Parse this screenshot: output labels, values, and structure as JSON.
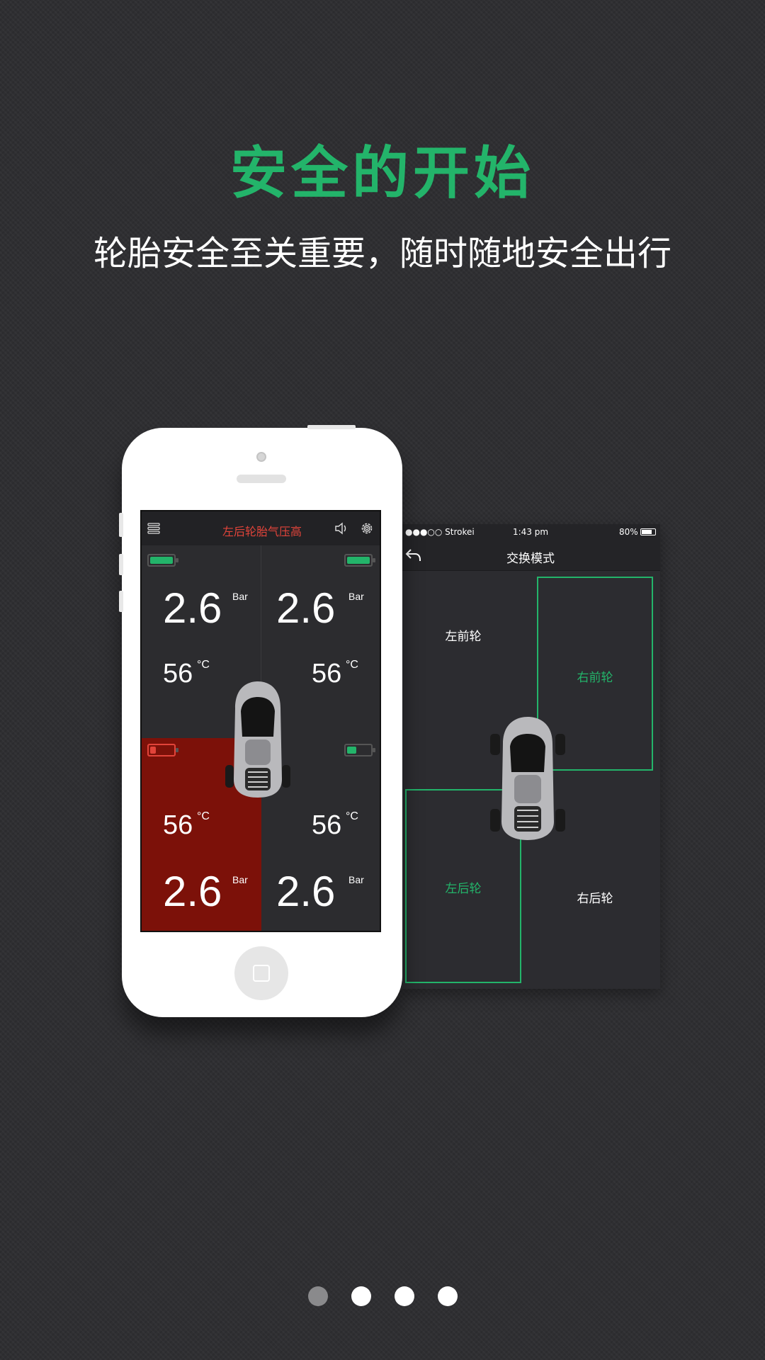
{
  "headline": "安全的开始",
  "subhead": "轮胎安全至关重要，随时随地安全出行",
  "phone_screen": {
    "alert_text": "左后轮胎气压高",
    "menu_icon": "menu-icon",
    "volume_icon": "speaker-icon",
    "settings_icon": "gear-icon",
    "tires": {
      "front_left": {
        "pressure": "2.6",
        "pressure_unit": "Bar",
        "temperature": "56",
        "temp_unit": "°C",
        "battery_level": 1.0,
        "battery_color": "#23b46a",
        "status": "normal"
      },
      "front_right": {
        "pressure": "2.6",
        "pressure_unit": "Bar",
        "temperature": "56",
        "temp_unit": "°C",
        "battery_level": 1.0,
        "battery_color": "#23b46a",
        "status": "normal"
      },
      "rear_left": {
        "pressure": "2.6",
        "pressure_unit": "Bar",
        "temperature": "56",
        "temp_unit": "°C",
        "battery_level": 0.25,
        "battery_color": "#e2443a",
        "status": "alert"
      },
      "rear_right": {
        "pressure": "2.6",
        "pressure_unit": "Bar",
        "temperature": "56",
        "temp_unit": "°C",
        "battery_level": 0.4,
        "battery_color": "#23b46a",
        "status": "normal"
      }
    }
  },
  "swap_screen": {
    "status_bar": {
      "carrier": "●●●○○ Strokei",
      "time": "1:43 pm",
      "battery": "80%"
    },
    "back_icon": "back-arrow-icon",
    "title": "交换模式",
    "wheels": {
      "front_left": "左前轮",
      "front_right": "右前轮",
      "rear_left": "左后轮",
      "rear_right": "右后轮"
    }
  },
  "colors": {
    "accent": "#23b46a",
    "alert": "#e2443a",
    "alert_bg": "#7c1109",
    "background": "#2f2f32"
  },
  "pager": {
    "count": 4,
    "active_index": 0
  }
}
